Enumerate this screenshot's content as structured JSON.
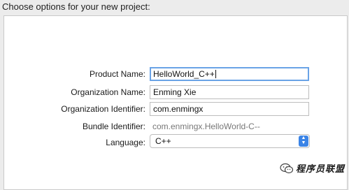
{
  "heading": "Choose options for your new project:",
  "form": {
    "product_name": {
      "label": "Product Name:",
      "value": "HelloWorld_C++"
    },
    "organization_name": {
      "label": "Organization Name:",
      "value": "Enming Xie"
    },
    "organization_identifier": {
      "label": "Organization Identifier:",
      "value": "com.enmingx"
    },
    "bundle_identifier": {
      "label": "Bundle Identifier:",
      "value": "com.enmingx.HelloWorld-C--"
    },
    "language": {
      "label": "Language:",
      "value": "C++"
    }
  },
  "watermark": {
    "text": "程序员联盟",
    "icon": "wechat-icon"
  }
}
